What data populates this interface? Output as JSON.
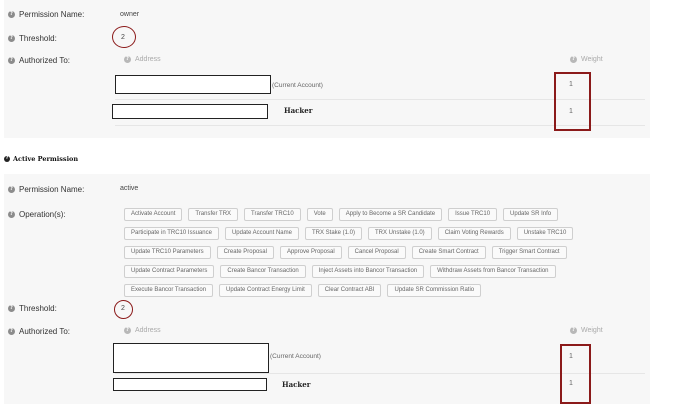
{
  "owner": {
    "permission_name_label": "Permission Name:",
    "permission_name": "owner",
    "threshold_label": "Threshold:",
    "threshold": "2",
    "authorized_label": "Authorized To:",
    "address_header": "Address",
    "weight_header": "Weight",
    "rows": [
      {
        "suffix": "(Current Account)",
        "weight": "1"
      },
      {
        "suffix": "Hacker",
        "weight": "1"
      }
    ]
  },
  "active_title": "Active Permission",
  "active": {
    "permission_name_label": "Permission Name:",
    "permission_name": "active",
    "operations_label": "Operation(s):",
    "operations": [
      [
        "Activate Account",
        "Transfer TRX",
        "Transfer TRC10",
        "Vote",
        "Apply to Become a SR Candidate",
        "Issue TRC10",
        "Update SR Info"
      ],
      [
        "Participate in TRC10 Issuance",
        "Update Account Name",
        "TRX Stake (1.0)",
        "TRX Unstake (1.0)",
        "Claim Voting Rewards",
        "Unstake TRC10"
      ],
      [
        "Update TRC10 Parameters",
        "Create Proposal",
        "Approve Proposal",
        "Cancel Proposal",
        "Create Smart Contract",
        "Trigger Smart Contract"
      ],
      [
        "Update Contract Parameters",
        "Create Bancor Transaction",
        "Inject Assets into Bancor Transaction",
        "Withdraw Assets from Bancor Transaction"
      ],
      [
        "Execute Bancor Transaction",
        "Update Contract Energy Limit",
        "Clear Contract ABI",
        "Update SR Commission Ratio"
      ]
    ],
    "threshold_label": "Threshold:",
    "threshold": "2",
    "authorized_label": "Authorized To:",
    "address_header": "Address",
    "weight_header": "Weight",
    "rows": [
      {
        "suffix": "(Current Account)",
        "weight": "1"
      },
      {
        "suffix": "Hacker",
        "weight": "1"
      }
    ]
  },
  "help_glyph": "?",
  "annotation_color": "#8b1a1a"
}
